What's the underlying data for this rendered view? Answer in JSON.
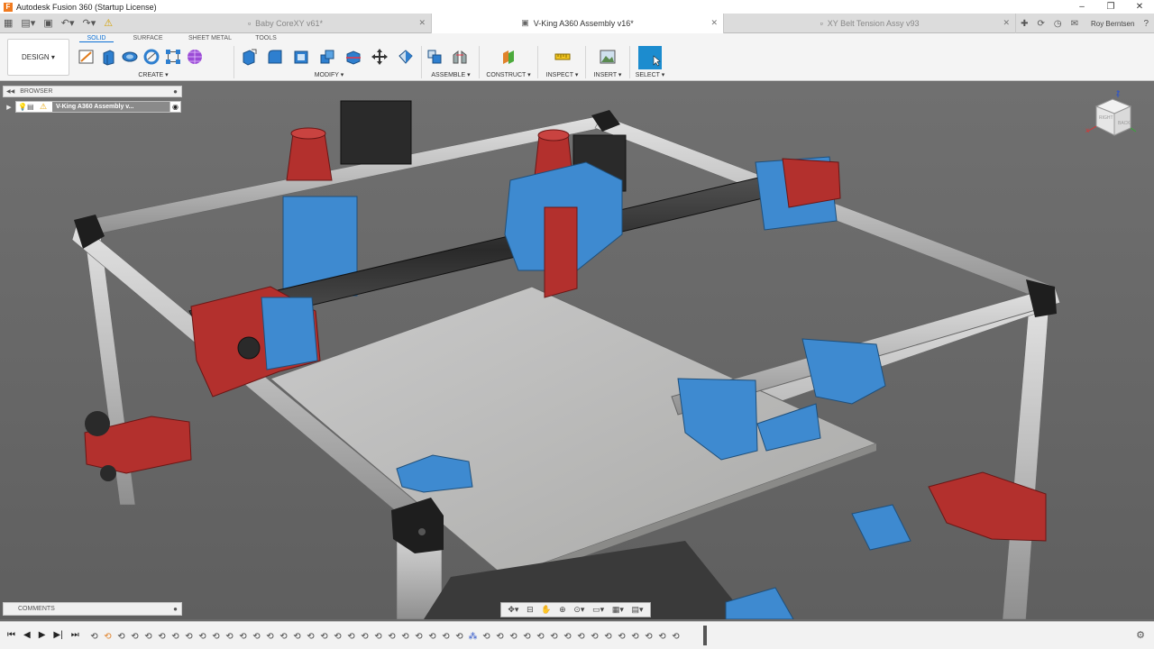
{
  "window": {
    "title": "Autodesk Fusion 360 (Startup License)",
    "controls": [
      "–",
      "❐",
      "✕"
    ]
  },
  "tabs": [
    {
      "label": "Baby CoreXY v61*",
      "active": false
    },
    {
      "label": "V-King A360 Assembly v16*",
      "active": true
    },
    {
      "label": "XY Belt Tension Assy v93",
      "active": false
    }
  ],
  "user": {
    "name": "Roy Berntsen"
  },
  "toolbar": {
    "design_label": "DESIGN ▾",
    "workspace_tabs": [
      "SOLID",
      "SURFACE",
      "SHEET METAL",
      "TOOLS"
    ],
    "groups": [
      {
        "label": "CREATE ▾"
      },
      {
        "label": "MODIFY ▾"
      },
      {
        "label": "ASSEMBLE ▾"
      },
      {
        "label": "CONSTRUCT ▾"
      },
      {
        "label": "INSPECT ▾"
      },
      {
        "label": "INSERT ▾"
      },
      {
        "label": "SELECT ▾"
      }
    ]
  },
  "browser": {
    "header": "BROWSER",
    "root_item": "V-King A360 Assembly v..."
  },
  "comments": {
    "header": "COMMENTS"
  },
  "viewcube": {
    "labels": [
      "RIGHT",
      "BACK"
    ]
  },
  "colors": {
    "accent": "#0b6fd4",
    "select_blue": "#1c8ccf",
    "frame_silver": "#c9c9c9",
    "part_red": "#b3302d",
    "part_blue": "#3d8fd2",
    "bed_gray": "#bfbfbd"
  }
}
